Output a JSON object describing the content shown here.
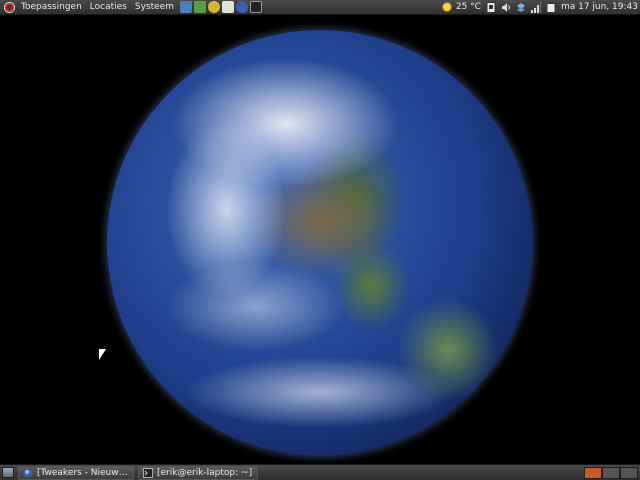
{
  "top_panel": {
    "menus": [
      "Toepassingen",
      "Locaties",
      "Systeem"
    ],
    "launchers": [
      {
        "name": "address-book-icon",
        "color": "#4a7fc0"
      },
      {
        "name": "network-icon",
        "color": "#5aa040"
      },
      {
        "name": "messenger-icon",
        "color": "#d9b23a"
      },
      {
        "name": "editor-icon",
        "color": "#e0e0d8"
      },
      {
        "name": "browser-icon",
        "color": "#3a5fb0"
      },
      {
        "name": "terminal-icon",
        "color": "#222222"
      }
    ],
    "weather": "25 °C",
    "clock": "ma 17 jun, 19:43"
  },
  "bottom_panel": {
    "tasks": [
      {
        "label": "[Tweakers - Nieuws, r...",
        "icon": "browser-icon"
      },
      {
        "label": "[erik@erik-laptop: ~]",
        "icon": "terminal-icon"
      }
    ],
    "workspace_colors": [
      "#c8582e",
      "#555555",
      "#555555"
    ]
  }
}
